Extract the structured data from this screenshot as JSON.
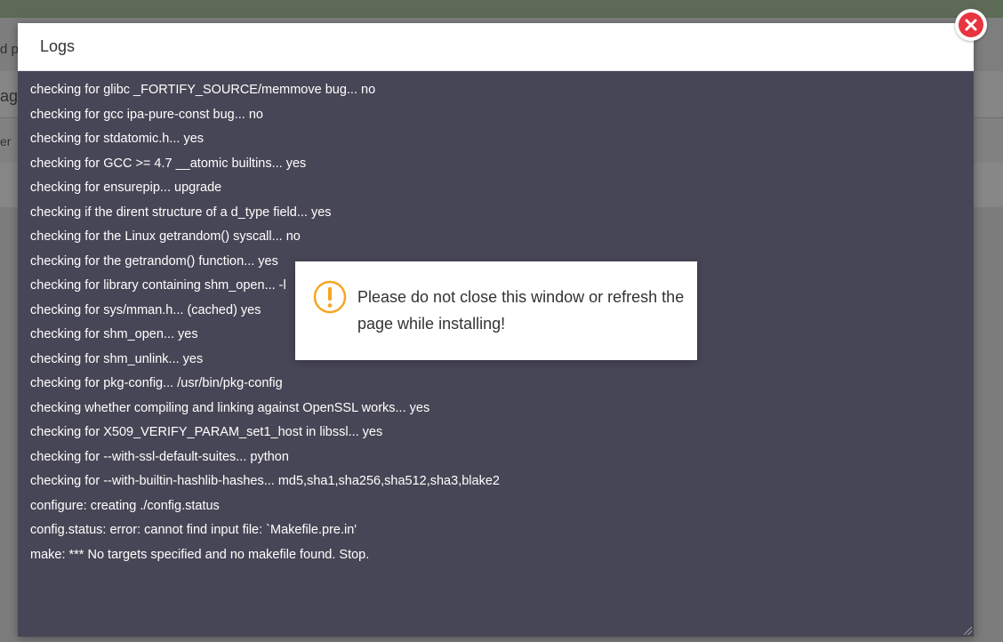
{
  "background": {
    "header_fragment": "d p",
    "subbar_fragment": "ag",
    "filter_fragment": "er"
  },
  "modal": {
    "title": "Logs",
    "close_icon": "close-icon",
    "log_lines": [
      "checking for glibc _FORTIFY_SOURCE/memmove bug... no",
      "checking for gcc ipa-pure-const bug... no",
      "checking for stdatomic.h... yes",
      "checking for GCC >= 4.7 __atomic builtins... yes",
      "checking for ensurepip... upgrade",
      "checking if the dirent structure of a d_type field... yes",
      "checking for the Linux getrandom() syscall... no",
      "checking for the getrandom() function... yes",
      "checking for library containing shm_open... -l",
      "checking for sys/mman.h... (cached) yes",
      "checking for shm_open... yes",
      "checking for shm_unlink... yes",
      "checking for pkg-config... /usr/bin/pkg-config",
      "checking whether compiling and linking against OpenSSL works... yes",
      "checking for X509_VERIFY_PARAM_set1_host in libssl... yes",
      "checking for --with-ssl-default-suites... python",
      "checking for --with-builtin-hashlib-hashes... md5,sha1,sha256,sha512,sha3,blake2",
      "configure: creating ./config.status",
      "config.status: error: cannot find input file: `Makefile.pre.in'",
      "make: *** No targets specified and no makefile found.  Stop."
    ]
  },
  "toast": {
    "icon": "warning-icon",
    "message": "Please do not close this window or refresh the page while installing!"
  },
  "colors": {
    "close_red": "#e8343f",
    "warning_orange": "#f5a623",
    "log_bg": "#474656"
  }
}
